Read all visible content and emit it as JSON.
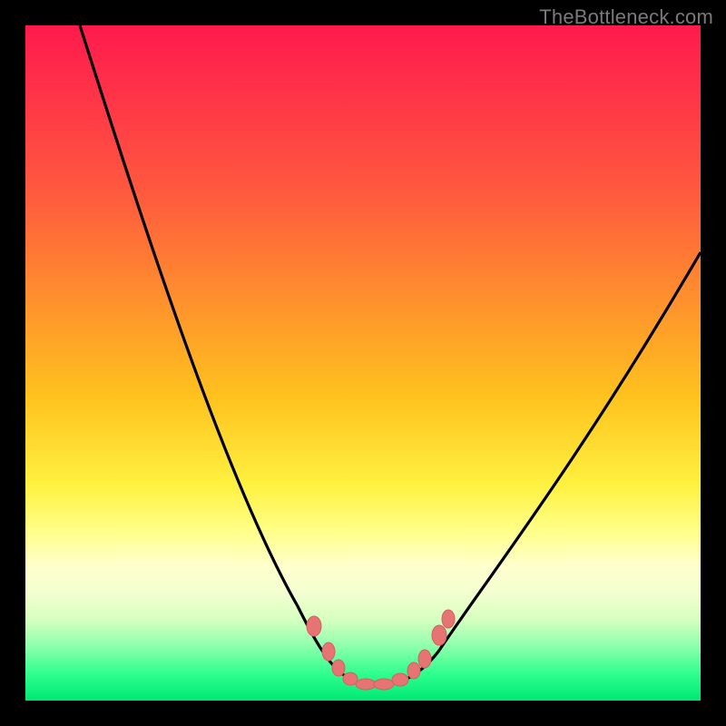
{
  "watermark": "TheBottleneck.com",
  "chart_data": {
    "type": "line",
    "title": "",
    "xlabel": "",
    "ylabel": "",
    "xlim": [
      0,
      100
    ],
    "ylim": [
      0,
      100
    ],
    "grid": false,
    "background": "rainbow-gradient-red-top-green-bottom",
    "series": [
      {
        "name": "bottleneck-curve",
        "color": "#000000",
        "x": [
          8,
          12,
          16,
          21,
          26,
          31,
          35,
          39,
          42,
          45,
          48,
          50,
          52,
          55,
          58,
          60,
          63,
          67,
          72,
          78,
          85,
          93,
          100
        ],
        "y": [
          100,
          90,
          79,
          66,
          53,
          41,
          31,
          22,
          15,
          9,
          5,
          3,
          2,
          2,
          3,
          5,
          9,
          15,
          23,
          33,
          44,
          56,
          67
        ]
      },
      {
        "name": "highlight-dots",
        "color": "#e96f6f",
        "type": "scatter",
        "x": [
          44,
          46,
          48,
          50,
          52,
          54,
          56,
          58,
          60
        ],
        "y": [
          10,
          6,
          3.5,
          2.5,
          2.3,
          2.5,
          3.5,
          6,
          10
        ]
      }
    ]
  }
}
